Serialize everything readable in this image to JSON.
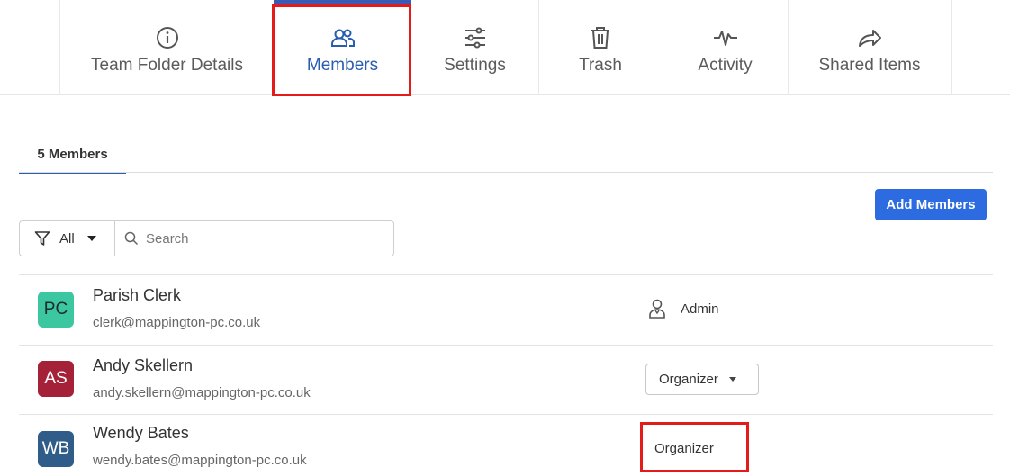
{
  "top_tabs": [
    {
      "label": "Team Folder Details",
      "icon": "info-icon"
    },
    {
      "label": "Members",
      "icon": "people-icon"
    },
    {
      "label": "Settings",
      "icon": "sliders-icon"
    },
    {
      "label": "Trash",
      "icon": "trash-icon"
    },
    {
      "label": "Activity",
      "icon": "activity-icon"
    },
    {
      "label": "Shared Items",
      "icon": "share-arrow-icon"
    }
  ],
  "sub_tab": {
    "label": "5 Members"
  },
  "toolbar": {
    "add_members_label": "Add Members"
  },
  "filter": {
    "label": "All"
  },
  "search": {
    "placeholder": "Search"
  },
  "members": [
    {
      "initials": "PC",
      "name": "Parish Clerk",
      "email": "clerk@mappington-pc.co.uk",
      "role": "Admin",
      "avatar_color": "#3cc7a0"
    },
    {
      "initials": "AS",
      "name": "Andy Skellern",
      "email": "andy.skellern@mappington-pc.co.uk",
      "role": "Organizer",
      "avatar_color": "#a52137"
    },
    {
      "initials": "WB",
      "name": "Wendy Bates",
      "email": "wendy.bates@mappington-pc.co.uk",
      "role": "Organizer",
      "avatar_color": "#2f5c88"
    }
  ],
  "colors": {
    "accent": "#2d6be0",
    "active_tab": "#2a5db0",
    "highlight": "#e31b1b"
  }
}
